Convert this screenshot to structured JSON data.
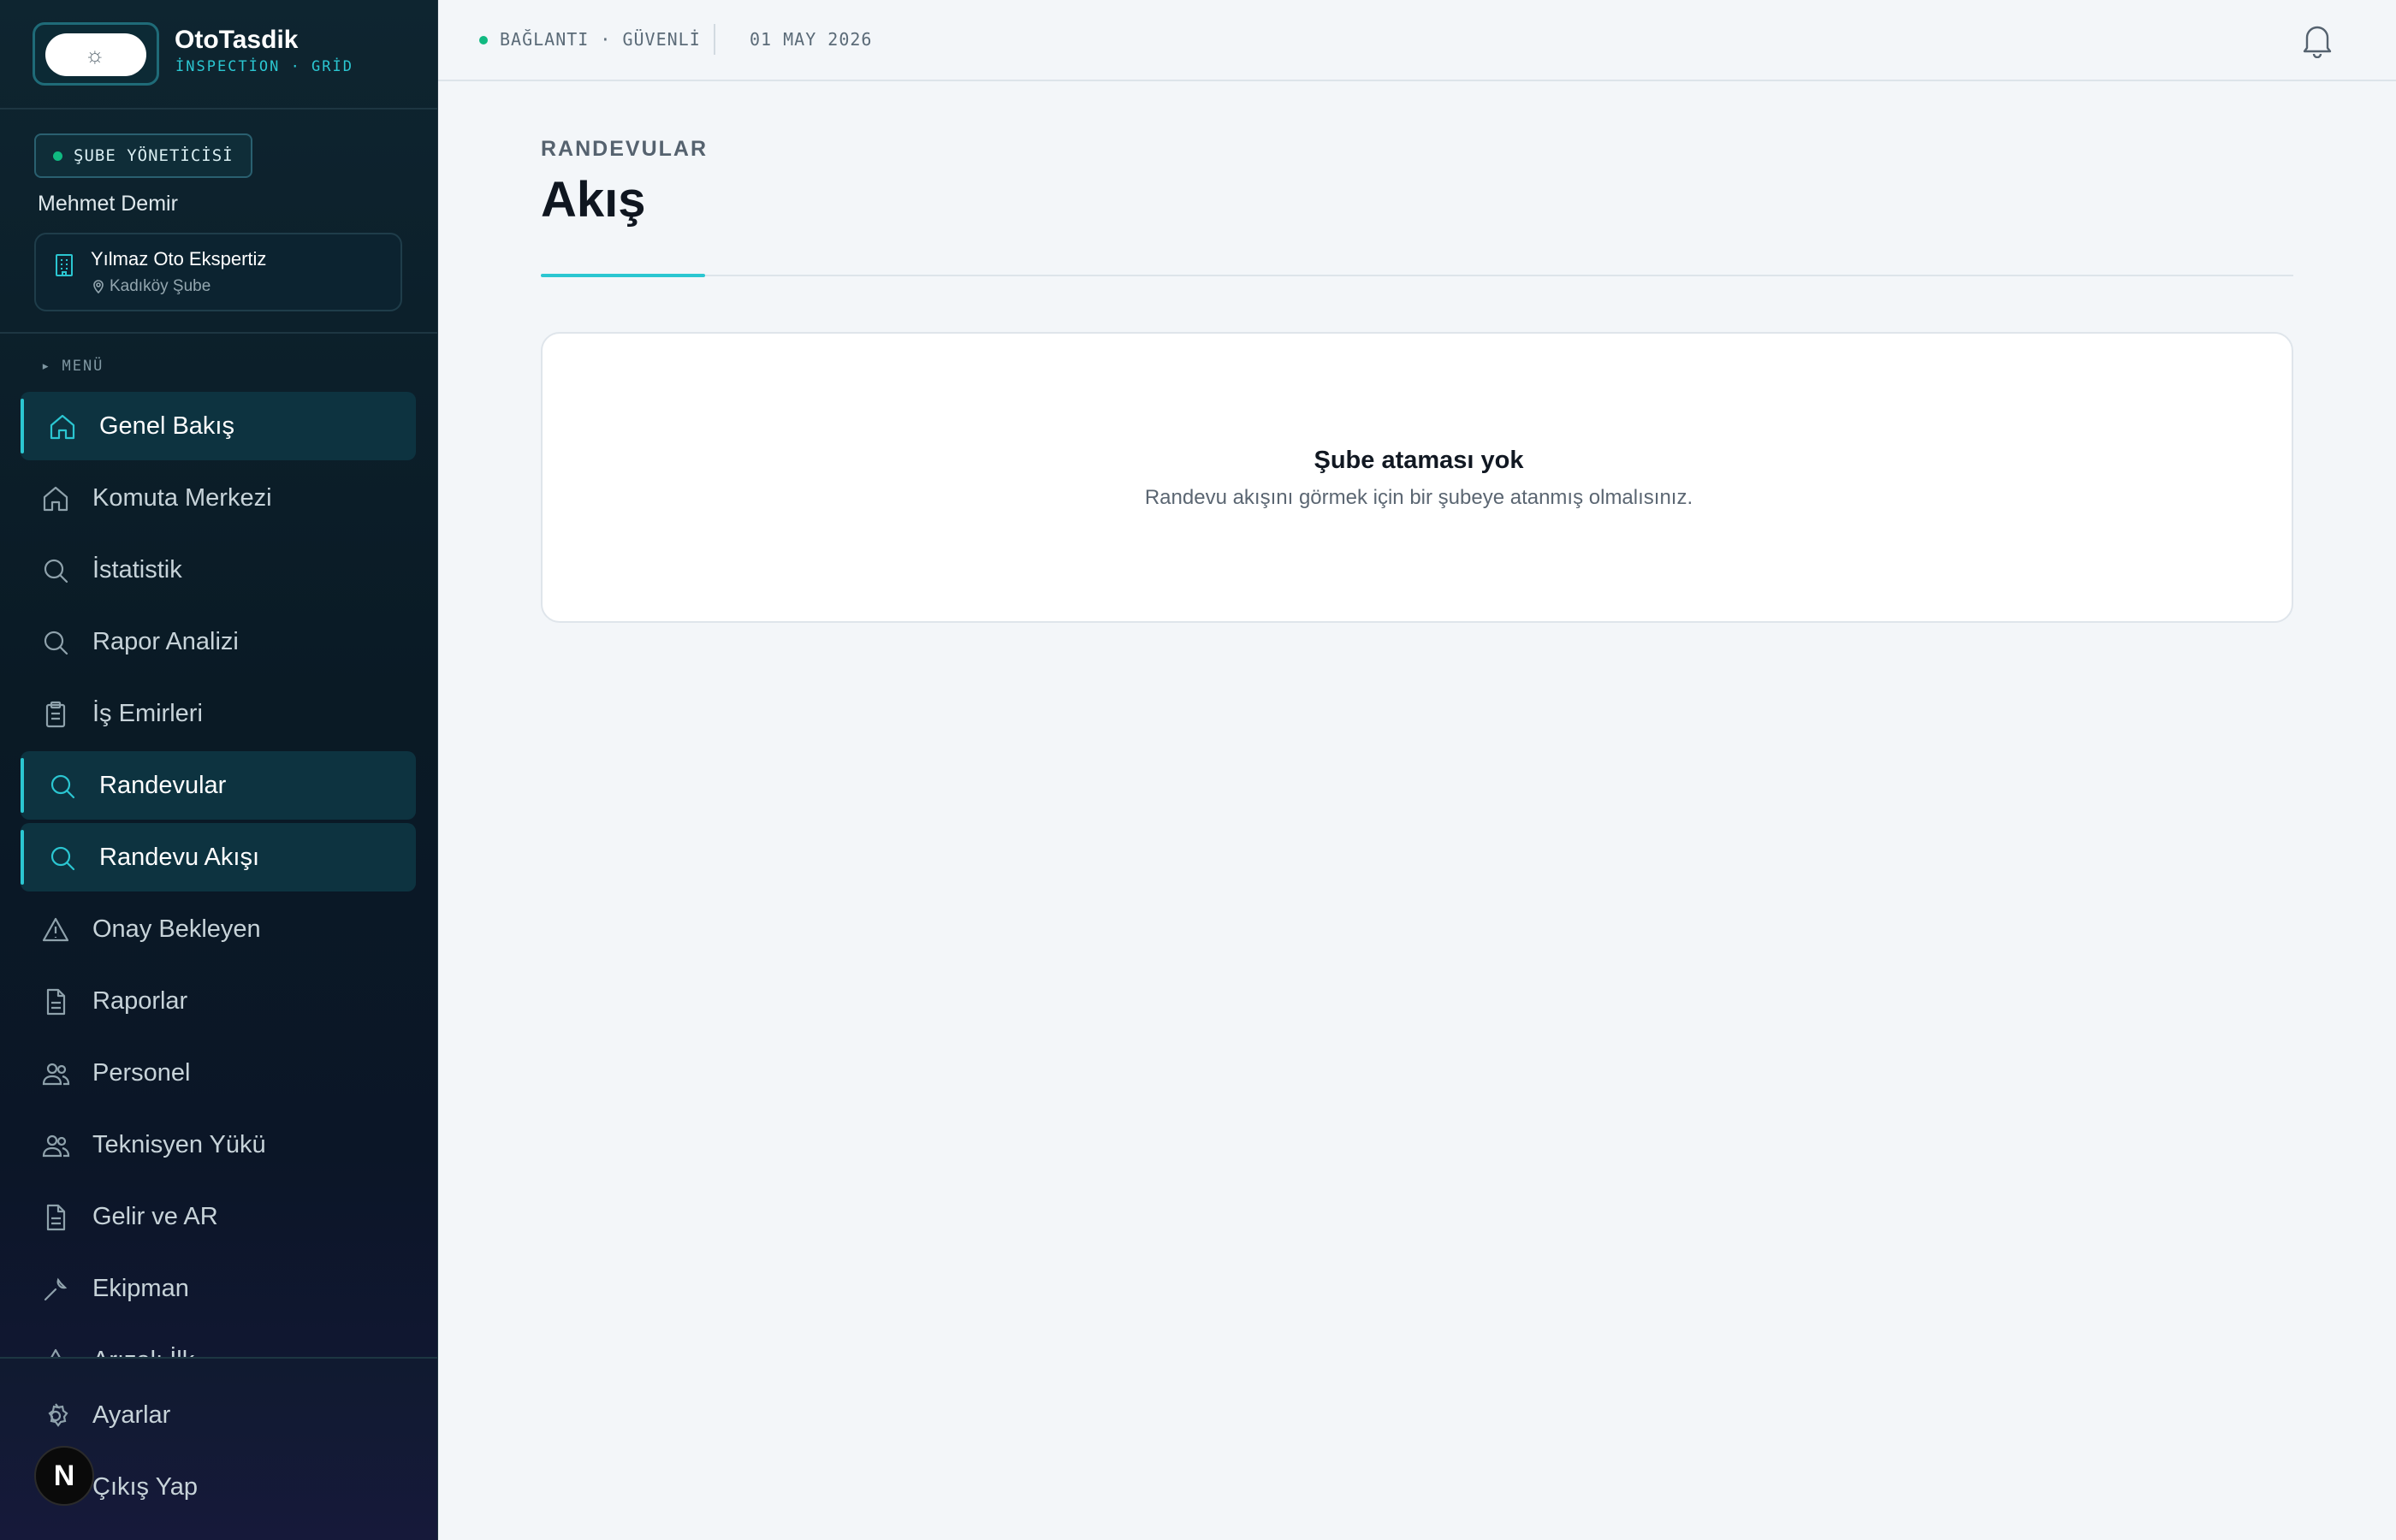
{
  "brand": {
    "title": "OtoTasdik",
    "subtitle": "İNSPECTİON · GRİD"
  },
  "user": {
    "role": "ŞUBE YÖNETİCİSİ",
    "name": "Mehmet Demir"
  },
  "branch": {
    "name": "Yılmaz Oto Ekspertiz",
    "location": "Kadıköy Şube"
  },
  "sidebar": {
    "menu_label": "▸ MENÜ",
    "items": [
      {
        "label": "Genel Bakış",
        "icon": "home-icon",
        "active": true
      },
      {
        "label": "Komuta Merkezi",
        "icon": "home-icon",
        "active": false
      },
      {
        "label": "İstatistik",
        "icon": "search-icon",
        "active": false
      },
      {
        "label": "Rapor Analizi",
        "icon": "search-icon",
        "active": false
      },
      {
        "label": "İş Emirleri",
        "icon": "clipboard-icon",
        "active": false
      },
      {
        "label": "Randevular",
        "icon": "search-icon",
        "active": true
      },
      {
        "label": "Randevu Akışı",
        "icon": "search-icon",
        "active": true
      },
      {
        "label": "Onay Bekleyen",
        "icon": "warning-icon",
        "active": false
      },
      {
        "label": "Raporlar",
        "icon": "file-icon",
        "active": false
      },
      {
        "label": "Personel",
        "icon": "users-icon",
        "active": false
      },
      {
        "label": "Teknisyen Yükü",
        "icon": "users-icon",
        "active": false
      },
      {
        "label": "Gelir ve AR",
        "icon": "file-icon",
        "active": false
      },
      {
        "label": "Ekipman",
        "icon": "wrench-icon",
        "active": false
      },
      {
        "label": "Arızalı İlk...",
        "icon": "warning-icon",
        "active": false
      }
    ],
    "bottom": {
      "settings": "Ayarlar",
      "logout": "Çıkış Yap"
    },
    "n_badge": "N"
  },
  "topbar": {
    "status": "BAĞLANTI · GÜVENLİ",
    "date": "01 MAY 2026"
  },
  "page": {
    "eyebrow": "RANDEVULAR",
    "title": "Akış",
    "empty_title": "Şube ataması yok",
    "empty_desc": "Randevu akışını görmek için bir şubeye atanmış olmalısınız."
  },
  "colors": {
    "accent": "#2bc6d1",
    "status_ok": "#10b981",
    "sidebar_bg": "#0a1a25",
    "active_bg": "#0d3340"
  }
}
